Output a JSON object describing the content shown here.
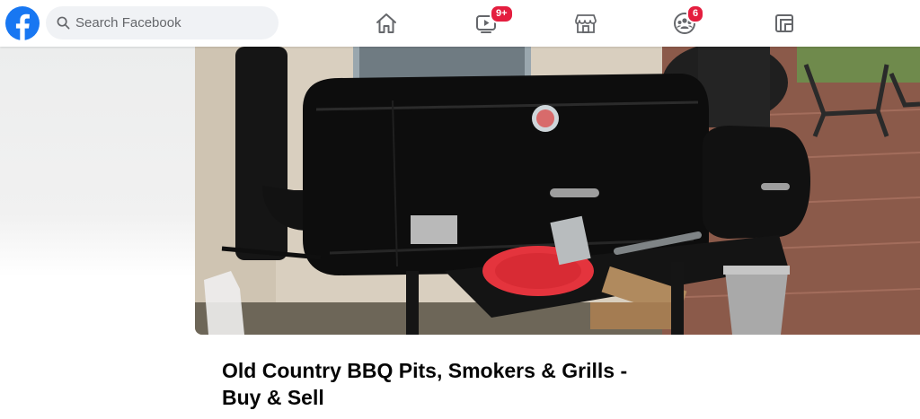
{
  "header": {
    "search": {
      "placeholder": "Search Facebook"
    },
    "nav": [
      {
        "icon": "home-icon"
      },
      {
        "icon": "watch-icon",
        "badge": "9+"
      },
      {
        "icon": "marketplace-icon"
      },
      {
        "icon": "groups-icon",
        "badge": "6"
      },
      {
        "icon": "gaming-icon"
      }
    ],
    "colors": {
      "brand": "#1877f2",
      "badge": "#e41e3f",
      "icon": "#65676b"
    }
  },
  "group": {
    "title": "Old Country BBQ Pits, Smokers & Grills - Buy & Sell",
    "cover_photo": "bbq-smoker-photo"
  }
}
